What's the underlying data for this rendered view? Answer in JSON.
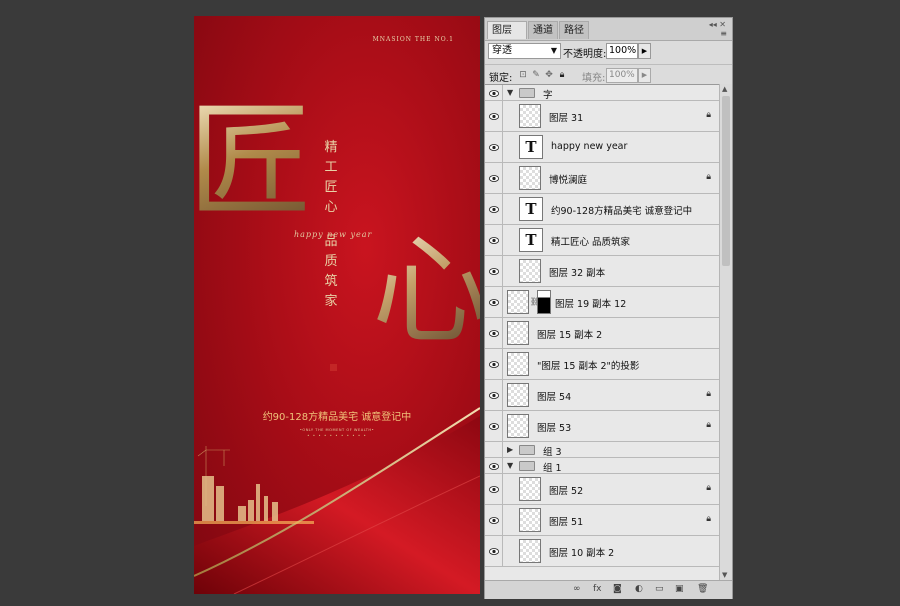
{
  "poster": {
    "brand": "MNASION THE NO.1",
    "big_char_1": "匠",
    "big_char_2": "心",
    "vertical_line_1": [
      "精",
      "工",
      "匠",
      "心"
    ],
    "vertical_line_2": [
      "品",
      "质",
      "筑",
      "家"
    ],
    "script_text": "happy new year",
    "promo": "约90-128方精品美宅  诚意登记中",
    "tiny_text": "•ONLY THE MOMENT OF WEALTH•",
    "dots": "• • • • • • • • • • •"
  },
  "panel": {
    "tabs": [
      {
        "label": "图层",
        "active": true
      },
      {
        "label": "通道",
        "active": false
      },
      {
        "label": "路径",
        "active": false
      }
    ],
    "close_glyph": "×",
    "blend_mode": "穿透",
    "opacity_label": "不透明度:",
    "opacity_value": "100%",
    "lock_label": "锁定:",
    "fill_label": "填充:",
    "fill_value": "100%",
    "layers": [
      {
        "kind": "group",
        "name": "字",
        "visible": true,
        "expanded": true,
        "indent": 0
      },
      {
        "kind": "raster",
        "name": "图层 31",
        "visible": true,
        "locked": true,
        "indent": 1
      },
      {
        "kind": "text",
        "name": "happy new year",
        "visible": true,
        "locked": false,
        "indent": 1
      },
      {
        "kind": "raster",
        "name": "博悦澜庭",
        "visible": true,
        "locked": true,
        "indent": 1
      },
      {
        "kind": "text",
        "name": "约90-128方精品美宅  诚意登记中",
        "visible": true,
        "locked": false,
        "indent": 1
      },
      {
        "kind": "text",
        "name": "精工匠心  品质筑家",
        "visible": true,
        "locked": false,
        "indent": 1
      },
      {
        "kind": "raster",
        "name": "图层 32 副本",
        "visible": true,
        "locked": false,
        "indent": 1
      },
      {
        "kind": "masked",
        "name": "图层 19 副本 12",
        "visible": true,
        "locked": false,
        "indent": 0
      },
      {
        "kind": "raster",
        "name": "图层 15 副本 2",
        "visible": true,
        "locked": false,
        "indent": 0
      },
      {
        "kind": "raster",
        "name": "\"图层 15 副本 2\"的投影",
        "visible": true,
        "locked": false,
        "indent": 0
      },
      {
        "kind": "raster",
        "name": "图层 54",
        "visible": true,
        "locked": true,
        "indent": 0
      },
      {
        "kind": "raster",
        "name": "图层 53",
        "visible": true,
        "locked": true,
        "indent": 0
      },
      {
        "kind": "group",
        "name": "组 3",
        "visible": false,
        "expanded": false,
        "indent": 0
      },
      {
        "kind": "group",
        "name": "组 1",
        "visible": true,
        "expanded": true,
        "indent": 0
      },
      {
        "kind": "raster",
        "name": "图层 52",
        "visible": true,
        "locked": true,
        "indent": 1
      },
      {
        "kind": "raster",
        "name": "图层 51",
        "visible": true,
        "locked": true,
        "indent": 1
      },
      {
        "kind": "raster",
        "name": "图层 10 副本 2",
        "visible": true,
        "locked": false,
        "indent": 1
      }
    ],
    "footer_icons": [
      "link-icon",
      "fx-icon",
      "mask-icon",
      "adjustment-icon",
      "new-group-icon",
      "new-layer-icon",
      "trash-icon"
    ],
    "footer_glyphs": [
      "∞",
      "fx",
      "◙",
      "◐",
      "▭",
      "▣",
      "🗑"
    ]
  },
  "colors": {
    "poster_red": "#b01019",
    "gold": "#d8bf8a",
    "panel_bg": "#dcdcdc",
    "workspace": "#3a3a3a"
  }
}
